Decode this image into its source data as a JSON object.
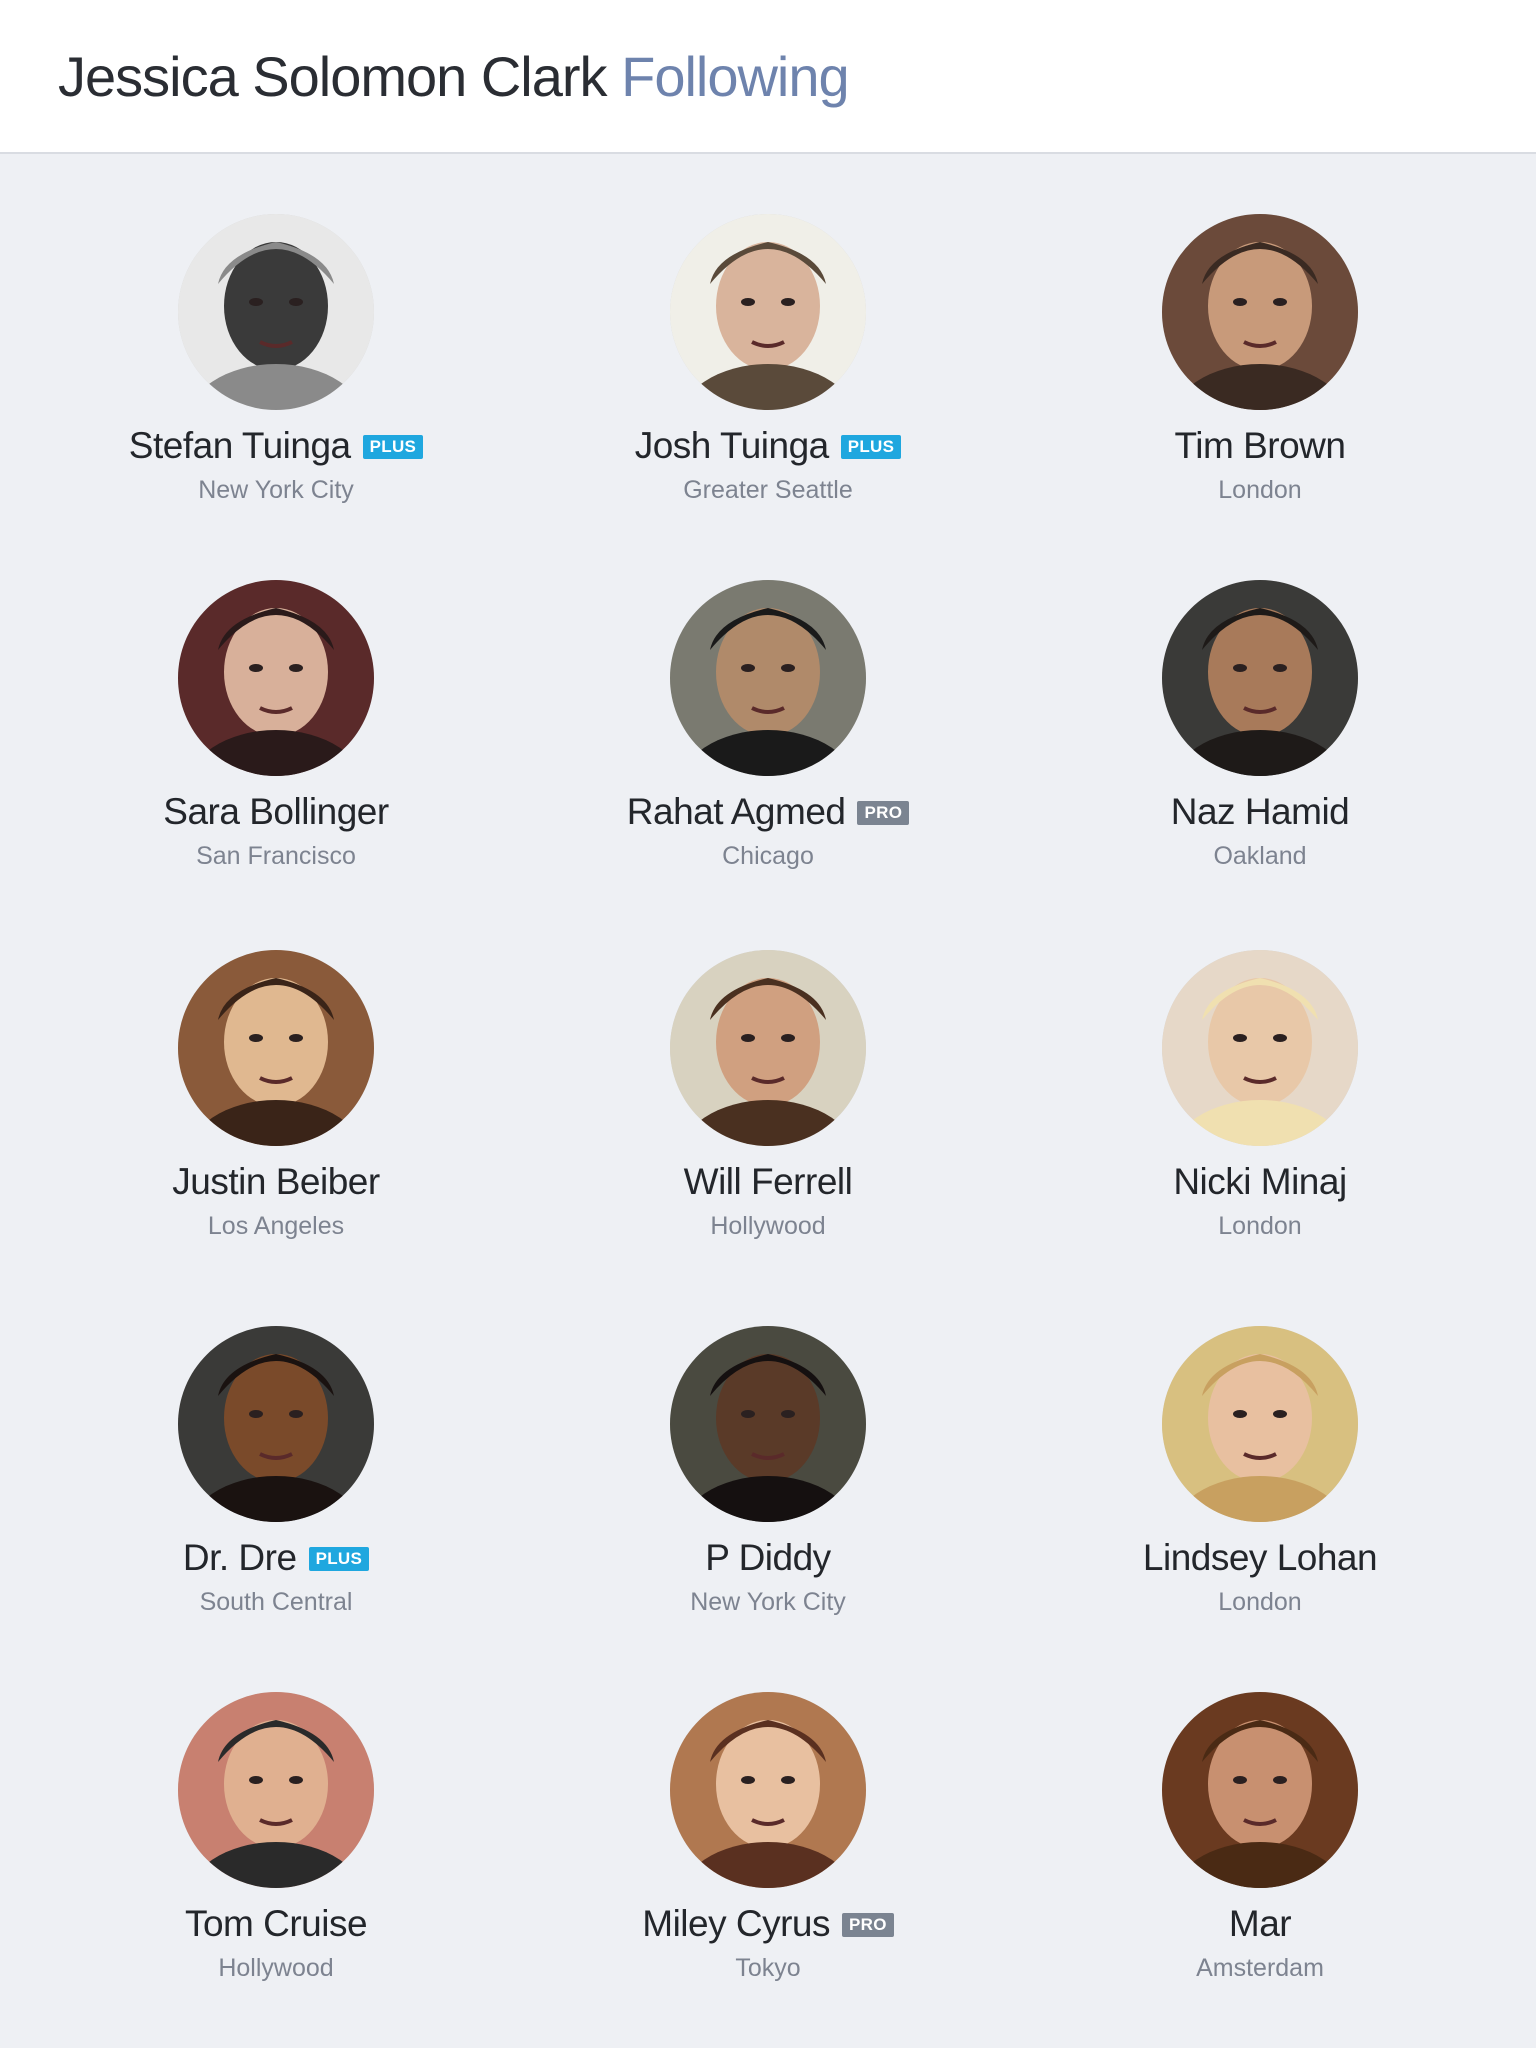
{
  "header": {
    "owner_name": "Jessica Solomon Clark",
    "section": "Following"
  },
  "colors": {
    "plus_badge": "#1fa7df",
    "pro_badge": "#7b8491",
    "section_title": "#6e83ad",
    "background": "#eef0f4"
  },
  "people": [
    {
      "name": "Stefan Tuinga",
      "location": "New York City",
      "badge": "PLUS",
      "avatar": "user-photo"
    },
    {
      "name": "Josh Tuinga",
      "location": "Greater Seattle",
      "badge": "PLUS",
      "avatar": "user-photo"
    },
    {
      "name": "Tim Brown",
      "location": "London",
      "badge": "",
      "avatar": "user-photo"
    },
    {
      "name": "Sara Bollinger",
      "location": "San Francisco",
      "badge": "",
      "avatar": "user-photo"
    },
    {
      "name": "Rahat Agmed",
      "location": "Chicago",
      "badge": "PRO",
      "avatar": "user-photo"
    },
    {
      "name": "Naz Hamid",
      "location": "Oakland",
      "badge": "",
      "avatar": "user-photo"
    },
    {
      "name": "Justin Beiber",
      "location": "Los Angeles",
      "badge": "",
      "avatar": "user-photo"
    },
    {
      "name": "Will Ferrell",
      "location": "Hollywood",
      "badge": "",
      "avatar": "user-photo"
    },
    {
      "name": "Nicki Minaj",
      "location": "London",
      "badge": "",
      "avatar": "user-photo"
    },
    {
      "name": "Dr. Dre",
      "location": "South Central",
      "badge": "PLUS",
      "avatar": "user-photo"
    },
    {
      "name": "P Diddy",
      "location": "New York City",
      "badge": "",
      "avatar": "user-photo"
    },
    {
      "name": "Lindsey Lohan",
      "location": "London",
      "badge": "",
      "avatar": "user-photo"
    },
    {
      "name": "Tom Cruise",
      "location": "Hollywood",
      "badge": "",
      "avatar": "user-photo"
    },
    {
      "name": "Miley Cyrus",
      "location": "Tokyo",
      "badge": "PRO",
      "avatar": "user-photo"
    },
    {
      "name": "Mar",
      "location": "Amsterdam",
      "badge": "",
      "avatar": "user-photo"
    }
  ]
}
